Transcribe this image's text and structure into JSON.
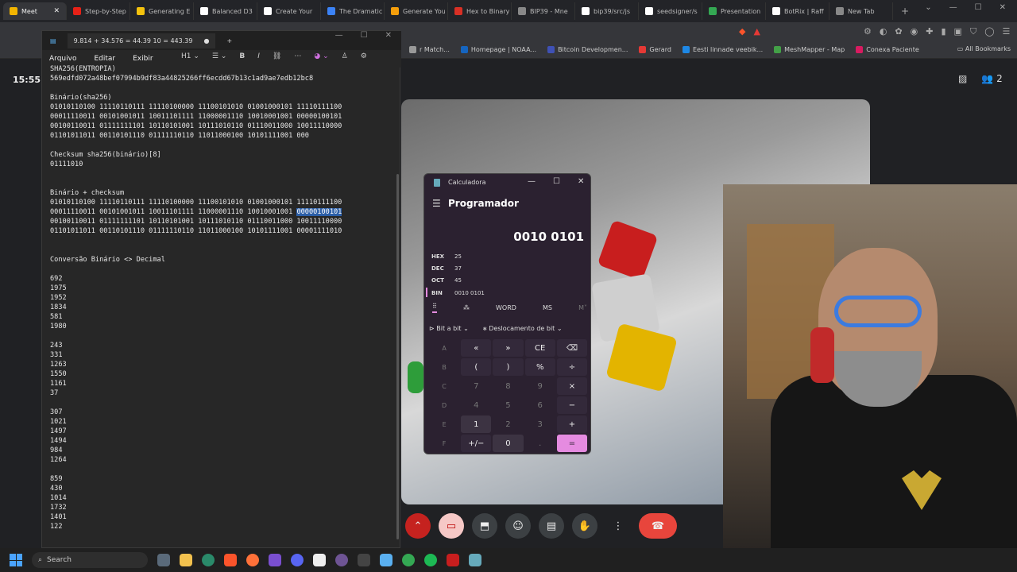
{
  "browser": {
    "tabs": [
      {
        "label": "Meet",
        "color": "#f2b400",
        "active": true
      },
      {
        "label": "Step-by-Step",
        "color": "#e62117"
      },
      {
        "label": "Generating E",
        "color": "#f4c20d"
      },
      {
        "label": "Balanced D3",
        "color": "#ffffff"
      },
      {
        "label": "Create Your",
        "color": "#ffffff"
      },
      {
        "label": "The Dramatic",
        "color": "#3b82f6"
      },
      {
        "label": "Generate You",
        "color": "#f59e0b"
      },
      {
        "label": "Hex to Binary",
        "color": "#d93025"
      },
      {
        "label": "BIP39 - Mne",
        "color": "#888888"
      },
      {
        "label": "bip39/src/js",
        "color": "#ffffff"
      },
      {
        "label": "seedsigner/s",
        "color": "#ffffff"
      },
      {
        "label": "Presentation",
        "color": "#34a853"
      },
      {
        "label": "BotRix | Raff",
        "color": "#ffffff"
      },
      {
        "label": "New Tab",
        "color": "#888888"
      }
    ],
    "bookmarks": [
      {
        "label": "r Match...",
        "color": "#999999"
      },
      {
        "label": "Homepage | NOAA...",
        "color": "#1565c0"
      },
      {
        "label": "Bitcoin Developmen...",
        "color": "#3f51b5"
      },
      {
        "label": "Gerard",
        "color": "#e53935"
      },
      {
        "label": "Eesti linnade veebik...",
        "color": "#1e88e5"
      },
      {
        "label": "MeshMapper - Map",
        "color": "#43a047"
      },
      {
        "label": "Conexa Paciente",
        "color": "#d81b60"
      }
    ],
    "all_bookmarks": "All Bookmarks"
  },
  "meet": {
    "clock": "15:55",
    "participant_count": "2"
  },
  "notepad": {
    "tab_title": "9.814 + 34.576 = 44.39 10 = 443.39",
    "menu": [
      "Arquivo",
      "Editar",
      "Exibir"
    ],
    "heading_style": "H1",
    "lines_before_hl": "SHA256(ENTROPIA)\n569edfd072a48bef07994b9df83a44825266ff6ecdd67b13c1ad9ae7edb12bc8\n\nBinário(sha256)\n01010110100 11110110111 11110100000 11100101010 01001000101 11110111100\n00011110011 00101001011 10011101111 11000001110 10010001001 00000100101\n00100110011 01111111101 10110101001 10111010110 01110011000 10011110000\n01101011011 00110101110 01111110110 11011000100 10101111001 000\n\nChecksum sha256(binário)[8]\n01111010\n\n\nBinário + checksum\n01010110100 11110110111 11110100000 11100101010 01001000101 11110111100\n00011110011 00101001011 10011101111 11000001110 10010001001 ",
    "highlight": "00000100101",
    "lines_after_hl": "\n00100110011 01111111101 10110101001 10111010110 01110011000 10011110000\n01101011011 00110101110 01111110110 11011000100 10101111001 00001111010\n\n\nConversão Binário <> Decimal\n\n692\n1975\n1952\n1834\n581\n1980\n\n243\n331\n1263\n1550\n1161\n37\n\n307\n1021\n1497\n1494\n984\n1264\n\n859\n430\n1014\n1732\n1401\n122"
  },
  "calculator": {
    "title": "Calculadora",
    "mode": "Programador",
    "display": "0010 0101",
    "radix": [
      {
        "label": "HEX",
        "value": "25"
      },
      {
        "label": "DEC",
        "value": "37"
      },
      {
        "label": "OCT",
        "value": "45"
      },
      {
        "label": "BIN",
        "value": "0010 0101"
      }
    ],
    "word": "WORD",
    "ms": "MS",
    "mv": "M˅",
    "bitwise": "Bit a bit",
    "bitshift": "Deslocamento de bit",
    "keys": [
      "A",
      "«",
      "»",
      "CE",
      "⌫",
      "B",
      "(",
      ")",
      "%",
      "÷",
      "C",
      "7",
      "8",
      "9",
      "×",
      "D",
      "4",
      "5",
      "6",
      "−",
      "E",
      "1",
      "2",
      "3",
      "+",
      "F",
      "+/−",
      "0",
      ".",
      "="
    ]
  },
  "taskbar": {
    "search": "Search"
  }
}
